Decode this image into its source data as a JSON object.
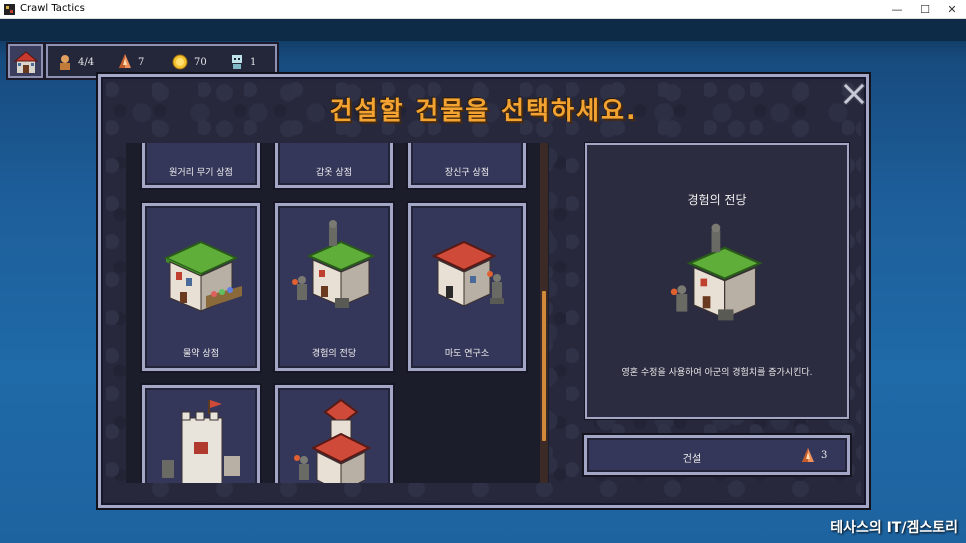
{
  "window": {
    "title": "Crawl Tactics",
    "minimize": "—",
    "maximize": "☐",
    "close": "✕"
  },
  "hud": {
    "units": "4/4",
    "crystals": "7",
    "gold": "70",
    "items": "1"
  },
  "dialog": {
    "title": "건설할 건물을 선택하세요.",
    "buildings": [
      {
        "label": "원거리 무기 상점"
      },
      {
        "label": "갑옷 상점"
      },
      {
        "label": "장신구 상점"
      },
      {
        "label": "물약 상점"
      },
      {
        "label": "경험의 전당"
      },
      {
        "label": "마도 연구소"
      },
      {
        "label": ""
      },
      {
        "label": ""
      }
    ],
    "scroll_fraction": 0.82,
    "detail": {
      "name": "경험의 전당",
      "description": "영혼 수정을 사용하여 아군의 경험치를 증가시킨다."
    },
    "build_button": {
      "label": "건설",
      "cost": "3"
    }
  },
  "watermark": "테사스의 IT/겜스토리",
  "colors": {
    "accent_title": "#f3a332",
    "panel_border": "#a3a6c4",
    "card_bg": "#35375a",
    "roof_green": "#5fae3a",
    "roof_red": "#d04a3a"
  },
  "icons": [
    "home-icon",
    "unit-icon",
    "crystal-icon",
    "gold-coin-icon",
    "skull-item-icon",
    "close-x-icon"
  ]
}
